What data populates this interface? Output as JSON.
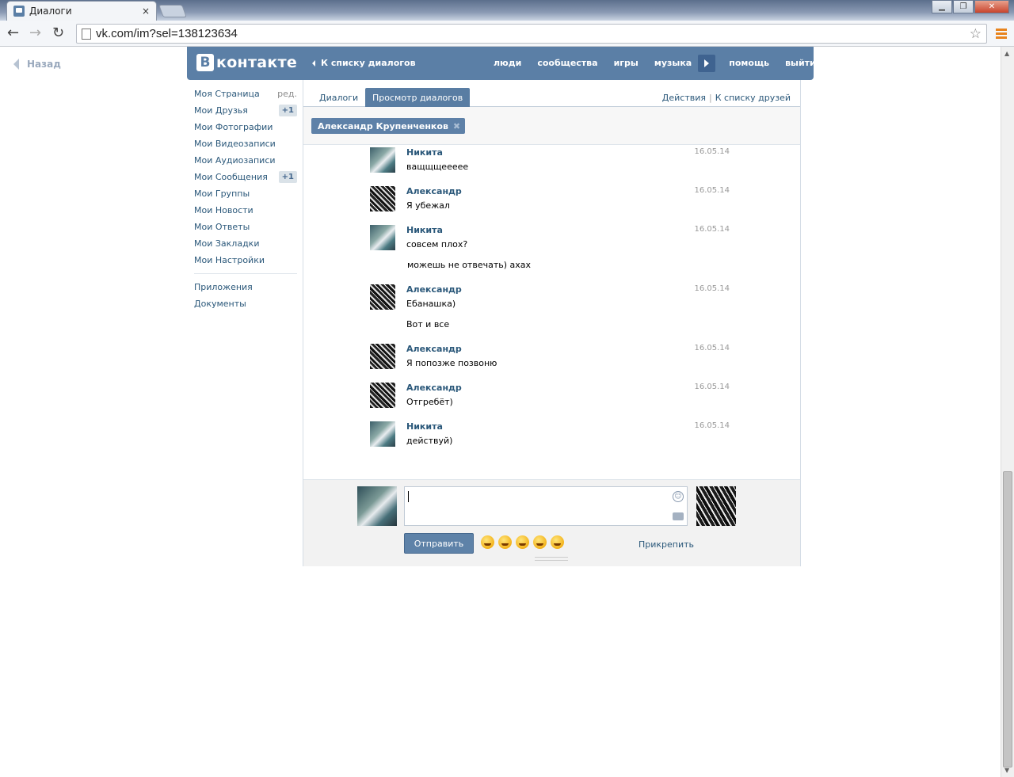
{
  "browser": {
    "tab_title": "Диалоги",
    "tab_close": "×",
    "url": "vk.com/im?sel=138123634"
  },
  "page": {
    "back_label": "Назад"
  },
  "header": {
    "logo_letter": "B",
    "logo_text": "контакте",
    "to_dialogs": "К списку диалогов",
    "nav": [
      "люди",
      "сообщества",
      "игры",
      "музыка",
      "помощь",
      "выйти"
    ],
    "bg_color": "#5b7fa6"
  },
  "sidebar": {
    "items": [
      {
        "label": "Моя Страница",
        "extra": "ред."
      },
      {
        "label": "Мои Друзья",
        "badge": "+1"
      },
      {
        "label": "Мои Фотографии"
      },
      {
        "label": "Мои Видеозаписи"
      },
      {
        "label": "Мои Аудиозаписи"
      },
      {
        "label": "Мои Сообщения",
        "badge": "+1"
      },
      {
        "label": "Мои Группы"
      },
      {
        "label": "Мои Новости"
      },
      {
        "label": "Мои Ответы"
      },
      {
        "label": "Мои Закладки"
      },
      {
        "label": "Мои Настройки"
      }
    ],
    "extra_items": [
      "Приложения",
      "Документы"
    ]
  },
  "tabs": {
    "dialogs": "Диалоги",
    "view": "Просмотр диалогов",
    "actions": "Действия",
    "friends_list": "К списку друзей",
    "separator": "|"
  },
  "peer": {
    "name": "Александр Крупенченков",
    "remove": "✖"
  },
  "messages": [
    {
      "author": "Никита",
      "date": "16.05.14",
      "lines": [
        "ващщщеееее"
      ]
    },
    {
      "author": "Александр",
      "date": "16.05.14",
      "lines": [
        "Я убежал"
      ]
    },
    {
      "author": "Никита",
      "date": "16.05.14",
      "lines": [
        "совсем плох?",
        "можешь не отвечать) ахах"
      ]
    },
    {
      "author": "Александр",
      "date": "16.05.14",
      "lines": [
        "Ебанашка)",
        "Вот и все"
      ]
    },
    {
      "author": "Александр",
      "date": "16.05.14",
      "lines": [
        "Я попозже позвоню"
      ]
    },
    {
      "author": "Александр",
      "date": "16.05.14",
      "lines": [
        "Отгребёт)"
      ]
    },
    {
      "author": "Никита",
      "date": "16.05.14",
      "lines": [
        "действуй)"
      ]
    }
  ],
  "compose": {
    "value": "",
    "send_label": "Отправить",
    "attach_label": "Прикрепить",
    "emoji_count": 5
  }
}
